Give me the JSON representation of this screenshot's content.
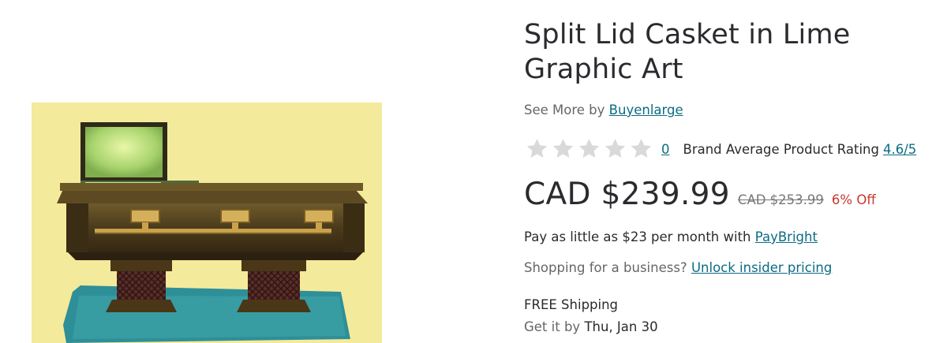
{
  "product": {
    "title": "Split Lid Casket in Lime Graphic Art",
    "image_alt": "Split Lid Casket in Lime Graphic Art"
  },
  "brand": {
    "see_more_prefix": "See More by",
    "name": "Buyenlarge"
  },
  "rating": {
    "stars_filled": 0,
    "stars_total": 5,
    "review_count": "0",
    "brand_average_label": "Brand Average Product Rating",
    "brand_average_value": "4.6/5"
  },
  "pricing": {
    "price": "CAD $239.99",
    "original_price": "CAD $253.99",
    "discount": "6% Off"
  },
  "financing": {
    "text": "Pay as little as $23 per month with",
    "provider": "PayBright"
  },
  "business": {
    "text": "Shopping for a business?",
    "link": "Unlock insider pricing"
  },
  "shipping": {
    "label": "FREE Shipping",
    "delivery_prefix": "Get it by",
    "delivery_date": "Thu, Jan 30"
  },
  "colors": {
    "link": "#0b6c84",
    "discount": "#c8372d",
    "star_empty": "#d9d9d9",
    "image_background": "#f4ea9b"
  },
  "icons": {
    "star": "star-outline-icon"
  }
}
